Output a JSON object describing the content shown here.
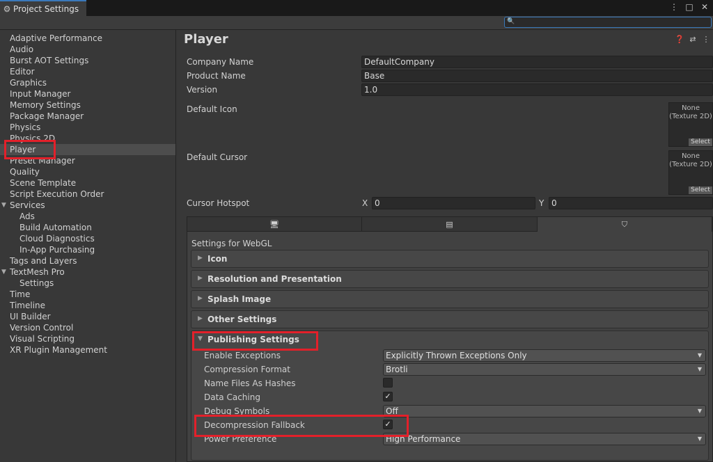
{
  "window": {
    "tab_title": "Project Settings",
    "tab_icon": "gear-icon",
    "controls": [
      "more-options-icon",
      "maximize-icon",
      "close-icon"
    ]
  },
  "search": {
    "placeholder": "",
    "value": ""
  },
  "sidebar": {
    "items": [
      {
        "label": "Adaptive Performance"
      },
      {
        "label": "Audio"
      },
      {
        "label": "Burst AOT Settings"
      },
      {
        "label": "Editor"
      },
      {
        "label": "Graphics"
      },
      {
        "label": "Input Manager"
      },
      {
        "label": "Memory Settings"
      },
      {
        "label": "Package Manager"
      },
      {
        "label": "Physics"
      },
      {
        "label": "Physics 2D"
      },
      {
        "label": "Player"
      },
      {
        "label": "Preset Manager"
      },
      {
        "label": "Quality"
      },
      {
        "label": "Scene Template"
      },
      {
        "label": "Script Execution Order"
      },
      {
        "label": "Services"
      },
      {
        "label": "Ads"
      },
      {
        "label": "Build Automation"
      },
      {
        "label": "Cloud Diagnostics"
      },
      {
        "label": "In-App Purchasing"
      },
      {
        "label": "Tags and Layers"
      },
      {
        "label": "TextMesh Pro"
      },
      {
        "label": "Settings"
      },
      {
        "label": "Time"
      },
      {
        "label": "Timeline"
      },
      {
        "label": "UI Builder"
      },
      {
        "label": "Version Control"
      },
      {
        "label": "Visual Scripting"
      },
      {
        "label": "XR Plugin Management"
      }
    ],
    "selected": "Player"
  },
  "main": {
    "title": "Player",
    "company_name": {
      "label": "Company Name",
      "value": "DefaultCompany"
    },
    "product_name": {
      "label": "Product Name",
      "value": "Base"
    },
    "version": {
      "label": "Version",
      "value": "1.0"
    },
    "default_icon": {
      "label": "Default Icon",
      "none": "None",
      "type": "(Texture 2D)",
      "select": "Select"
    },
    "default_cursor": {
      "label": "Default Cursor",
      "none": "None",
      "type": "(Texture 2D)",
      "select": "Select"
    },
    "cursor_hotspot": {
      "label": "Cursor Hotspot",
      "x_label": "X",
      "x_value": "0",
      "y_label": "Y",
      "y_value": "0"
    },
    "platform_tabs": [
      "monitor-icon",
      "server-icon",
      "html5-icon"
    ],
    "settings_for": "Settings for WebGL",
    "sections": {
      "icon": "Icon",
      "resolution": "Resolution and Presentation",
      "splash": "Splash Image",
      "other": "Other Settings",
      "publishing": "Publishing Settings"
    },
    "publishing": {
      "enable_exceptions": {
        "label": "Enable Exceptions",
        "value": "Explicitly Thrown Exceptions Only"
      },
      "compression_format": {
        "label": "Compression Format",
        "value": "Brotli"
      },
      "name_files_as_hashes": {
        "label": "Name Files As Hashes",
        "checked": false
      },
      "data_caching": {
        "label": "Data Caching",
        "checked": true,
        "mark": "✓"
      },
      "debug_symbols": {
        "label": "Debug Symbols",
        "value": "Off"
      },
      "decompression_fallback": {
        "label": "Decompression Fallback",
        "checked": true,
        "mark": "✓"
      },
      "power_preference": {
        "label": "Power Preference",
        "value": "High Performance"
      }
    }
  },
  "colors": {
    "highlight": "#e3202a",
    "accent": "#3a79bb"
  }
}
